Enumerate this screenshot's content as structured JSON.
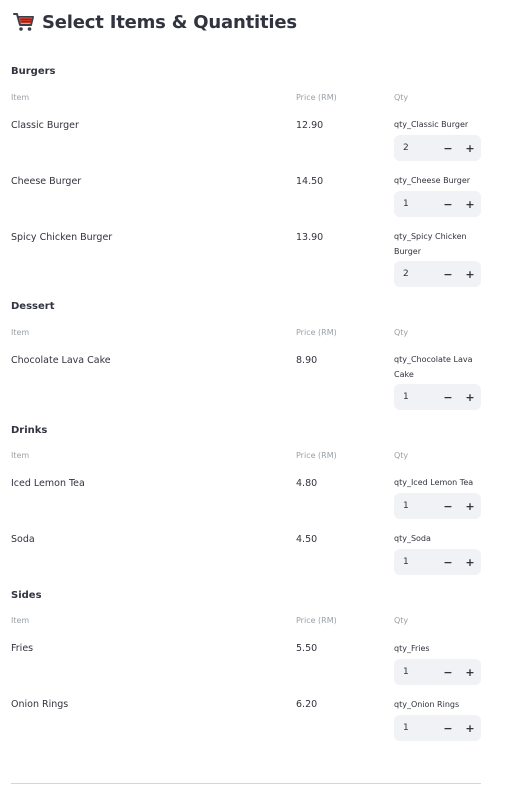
{
  "page": {
    "title": "Select Items & Quantities",
    "title_icon": "shopping-cart-icon"
  },
  "columns": {
    "item": "Item",
    "price": "Price (RM)",
    "qty": "Qty"
  },
  "stepper": {
    "minus": "−",
    "plus": "+"
  },
  "sections": [
    {
      "title": "Burgers",
      "items": [
        {
          "name": "Classic Burger",
          "price": "12.90",
          "qty_label": "qty_Classic Burger",
          "qty": "2"
        },
        {
          "name": "Cheese Burger",
          "price": "14.50",
          "qty_label": "qty_Cheese Burger",
          "qty": "1"
        },
        {
          "name": "Spicy Chicken Burger",
          "price": "13.90",
          "qty_label": "qty_Spicy Chicken Burger",
          "qty": "2"
        }
      ]
    },
    {
      "title": "Dessert",
      "items": [
        {
          "name": "Chocolate Lava Cake",
          "price": "8.90",
          "qty_label": "qty_Chocolate Lava Cake",
          "qty": "1"
        }
      ]
    },
    {
      "title": "Drinks",
      "items": [
        {
          "name": "Iced Lemon Tea",
          "price": "4.80",
          "qty_label": "qty_Iced Lemon Tea",
          "qty": "1"
        },
        {
          "name": "Soda",
          "price": "4.50",
          "qty_label": "qty_Soda",
          "qty": "1"
        }
      ]
    },
    {
      "title": "Sides",
      "items": [
        {
          "name": "Fries",
          "price": "5.50",
          "qty_label": "qty_Fries",
          "qty": "1"
        },
        {
          "name": "Onion Rings",
          "price": "6.20",
          "qty_label": "qty_Onion Rings",
          "qty": "1"
        }
      ]
    }
  ]
}
